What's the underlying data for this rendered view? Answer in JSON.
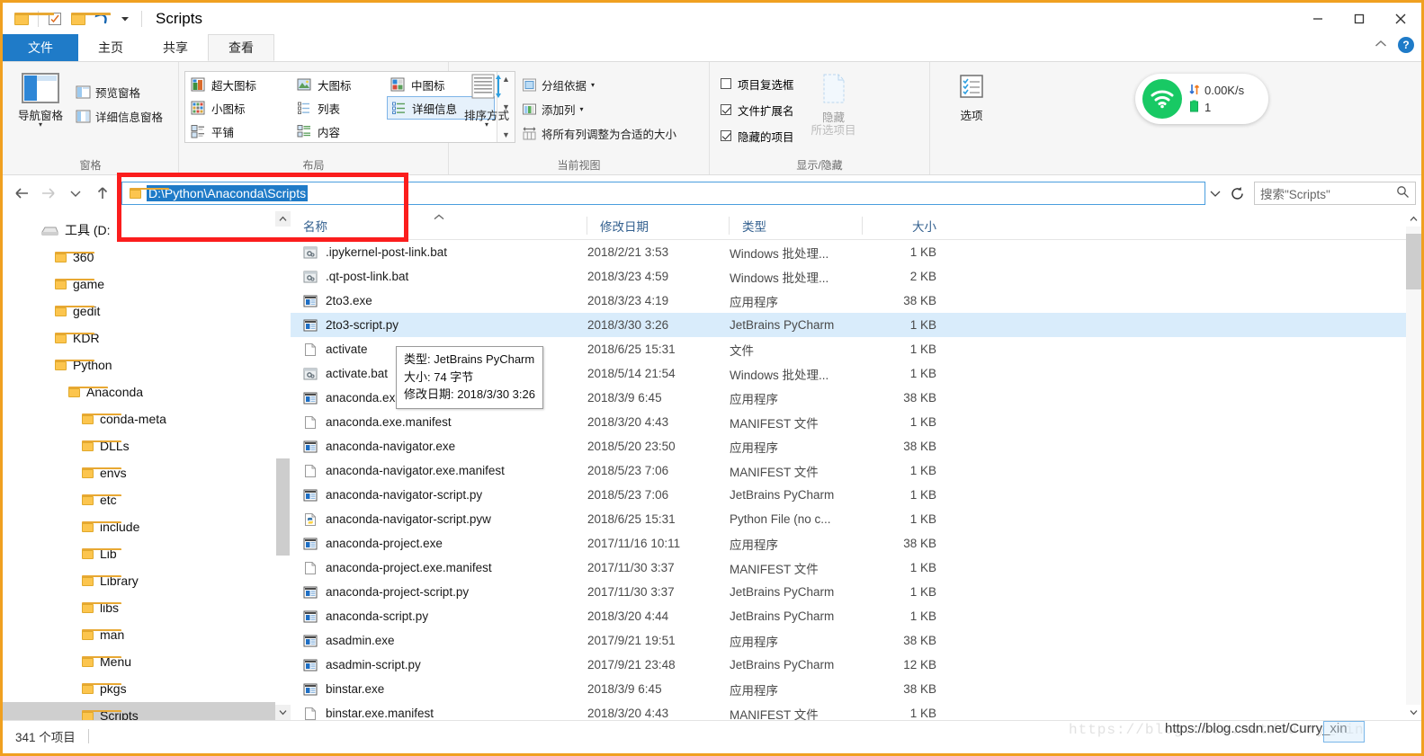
{
  "window": {
    "title": "Scripts",
    "minimize": "—",
    "maximize": "□",
    "close": "✕",
    "ribbon_collapse": "^",
    "help": "?"
  },
  "quick_access": {
    "folder_icon": "folder-icon",
    "properties_icon": "properties-checkbox-icon",
    "new_folder_icon": "new-folder-icon",
    "undo_icon": "undo-icon",
    "customize_icon": "chevron-down-icon"
  },
  "tabs": [
    {
      "label": "文件",
      "kind": "file"
    },
    {
      "label": "主页",
      "kind": "normal"
    },
    {
      "label": "共享",
      "kind": "normal"
    },
    {
      "label": "查看",
      "kind": "active"
    }
  ],
  "ribbon": {
    "groups": [
      {
        "name": "panes",
        "label": "窗格",
        "big_button": {
          "label": "导航窗格",
          "icon": "navigation-pane-icon"
        },
        "small_buttons": [
          {
            "label": "预览窗格",
            "icon": "preview-pane-icon"
          },
          {
            "label": "详细信息窗格",
            "icon": "details-pane-icon"
          }
        ]
      },
      {
        "name": "layout",
        "label": "布局",
        "items": [
          {
            "label": "超大图标",
            "icon": "extra-large-icons-icon",
            "selected": false
          },
          {
            "label": "大图标",
            "icon": "large-icons-icon",
            "selected": false
          },
          {
            "label": "中图标",
            "icon": "medium-icons-icon",
            "selected": false
          },
          {
            "label": "小图标",
            "icon": "small-icons-icon",
            "selected": false
          },
          {
            "label": "列表",
            "icon": "list-view-icon",
            "selected": false
          },
          {
            "label": "详细信息",
            "icon": "details-view-icon",
            "selected": true
          },
          {
            "label": "平铺",
            "icon": "tiles-view-icon",
            "selected": false
          },
          {
            "label": "内容",
            "icon": "content-view-icon",
            "selected": false
          }
        ]
      },
      {
        "name": "current_view",
        "label": "当前视图",
        "big_button": {
          "label": "排序方式",
          "icon": "sort-by-icon"
        },
        "small_buttons": [
          {
            "label": "分组依据",
            "icon": "group-by-icon",
            "has_caret": true
          },
          {
            "label": "添加列",
            "icon": "add-columns-icon",
            "has_caret": true
          },
          {
            "label": "将所有列调整为合适的大小",
            "icon": "size-columns-to-fit-icon",
            "has_caret": false
          }
        ]
      },
      {
        "name": "show_hide",
        "label": "显示/隐藏",
        "checkboxes": [
          {
            "label": "项目复选框",
            "checked": false
          },
          {
            "label": "文件扩展名",
            "checked": true
          },
          {
            "label": "隐藏的项目",
            "checked": true
          }
        ],
        "big_button": {
          "label_line1": "隐藏",
          "label_line2": "所选项目",
          "icon": "hide-selected-items-icon",
          "disabled": true
        }
      },
      {
        "name": "options",
        "label": "",
        "big_button": {
          "label": "选项",
          "icon": "options-icon"
        }
      }
    ]
  },
  "net_widget": {
    "icon": "wifi-icon",
    "speed": "0.00K/s",
    "speed_icon": "up-down-arrow-icon",
    "battery_value": "1",
    "battery_icon": "battery-icon",
    "accent": "#18c964"
  },
  "address_bar": {
    "back_icon": "back-arrow-icon",
    "forward_icon": "forward-arrow-icon",
    "recent_icon": "chevron-down-icon",
    "up_icon": "up-arrow-icon",
    "folder_icon": "folder-icon",
    "path": "D:\\Python\\Anaconda\\Scripts",
    "dropdown_icon": "chevron-down-icon",
    "refresh_icon": "refresh-icon"
  },
  "search": {
    "placeholder": "搜索\"Scripts\"",
    "icon": "search-icon"
  },
  "nav_pane": {
    "items": [
      {
        "label": "工具 (D:",
        "icon": "drive-icon",
        "indent": 0,
        "selected": false
      },
      {
        "label": "360",
        "icon": "folder-icon",
        "indent": 1,
        "selected": false
      },
      {
        "label": "game",
        "icon": "folder-icon",
        "indent": 1,
        "selected": false
      },
      {
        "label": "gedit",
        "icon": "folder-icon",
        "indent": 1,
        "selected": false
      },
      {
        "label": "KDR",
        "icon": "folder-icon",
        "indent": 1,
        "selected": false
      },
      {
        "label": "Python",
        "icon": "folder-icon",
        "indent": 1,
        "selected": false
      },
      {
        "label": "Anaconda",
        "icon": "folder-icon",
        "indent": 2,
        "selected": false
      },
      {
        "label": "conda-meta",
        "icon": "folder-icon",
        "indent": 3,
        "selected": false
      },
      {
        "label": "DLLs",
        "icon": "folder-icon",
        "indent": 3,
        "selected": false
      },
      {
        "label": "envs",
        "icon": "folder-icon",
        "indent": 3,
        "selected": false
      },
      {
        "label": "etc",
        "icon": "folder-icon",
        "indent": 3,
        "selected": false
      },
      {
        "label": "include",
        "icon": "folder-icon",
        "indent": 3,
        "selected": false
      },
      {
        "label": "Lib",
        "icon": "folder-icon",
        "indent": 3,
        "selected": false
      },
      {
        "label": "Library",
        "icon": "folder-icon",
        "indent": 3,
        "selected": false
      },
      {
        "label": "libs",
        "icon": "folder-icon",
        "indent": 3,
        "selected": false
      },
      {
        "label": "man",
        "icon": "folder-icon",
        "indent": 3,
        "selected": false
      },
      {
        "label": "Menu",
        "icon": "folder-icon",
        "indent": 3,
        "selected": false
      },
      {
        "label": "pkgs",
        "icon": "folder-icon",
        "indent": 3,
        "selected": false
      },
      {
        "label": "Scripts",
        "icon": "folder-icon",
        "indent": 3,
        "selected": true
      }
    ]
  },
  "file_list": {
    "columns": [
      {
        "key": "name",
        "label": "名称",
        "sorted": true,
        "sort_dir": "asc"
      },
      {
        "key": "date",
        "label": "修改日期",
        "sorted": false
      },
      {
        "key": "type",
        "label": "类型",
        "sorted": false
      },
      {
        "key": "size",
        "label": "大小",
        "sorted": false
      }
    ],
    "rows": [
      {
        "name": ".ipykernel-post-link.bat",
        "date": "2018/2/21 3:53",
        "type": "Windows 批处理...",
        "size": "1 KB",
        "icon": "bat-file-icon",
        "selected": false
      },
      {
        "name": ".qt-post-link.bat",
        "date": "2018/3/23 4:59",
        "type": "Windows 批处理...",
        "size": "2 KB",
        "icon": "bat-file-icon",
        "selected": false
      },
      {
        "name": "2to3.exe",
        "date": "2018/3/23 4:19",
        "type": "应用程序",
        "size": "38 KB",
        "icon": "exe-file-icon",
        "selected": false
      },
      {
        "name": "2to3-script.py",
        "date": "2018/3/30 3:26",
        "type": "JetBrains PyCharm",
        "size": "1 KB",
        "icon": "exe-file-icon",
        "selected": true
      },
      {
        "name": "activate",
        "date": "2018/6/25 15:31",
        "type": "文件",
        "size": "1 KB",
        "icon": "blank-file-icon",
        "selected": false
      },
      {
        "name": "activate.bat",
        "date": "2018/5/14 21:54",
        "type": "Windows 批处理...",
        "size": "1 KB",
        "icon": "bat-file-icon",
        "selected": false
      },
      {
        "name": "anaconda.exe",
        "date": "2018/3/9 6:45",
        "type": "应用程序",
        "size": "38 KB",
        "icon": "exe-file-icon",
        "selected": false
      },
      {
        "name": "anaconda.exe.manifest",
        "date": "2018/3/20 4:43",
        "type": "MANIFEST 文件",
        "size": "1 KB",
        "icon": "blank-file-icon",
        "selected": false
      },
      {
        "name": "anaconda-navigator.exe",
        "date": "2018/5/20 23:50",
        "type": "应用程序",
        "size": "38 KB",
        "icon": "exe-file-icon",
        "selected": false
      },
      {
        "name": "anaconda-navigator.exe.manifest",
        "date": "2018/5/23 7:06",
        "type": "MANIFEST 文件",
        "size": "1 KB",
        "icon": "blank-file-icon",
        "selected": false
      },
      {
        "name": "anaconda-navigator-script.py",
        "date": "2018/5/23 7:06",
        "type": "JetBrains PyCharm",
        "size": "1 KB",
        "icon": "exe-file-icon",
        "selected": false
      },
      {
        "name": "anaconda-navigator-script.pyw",
        "date": "2018/6/25 15:31",
        "type": "Python File (no c...",
        "size": "1 KB",
        "icon": "python-file-icon",
        "selected": false
      },
      {
        "name": "anaconda-project.exe",
        "date": "2017/11/16 10:11",
        "type": "应用程序",
        "size": "38 KB",
        "icon": "exe-file-icon",
        "selected": false
      },
      {
        "name": "anaconda-project.exe.manifest",
        "date": "2017/11/30 3:37",
        "type": "MANIFEST 文件",
        "size": "1 KB",
        "icon": "blank-file-icon",
        "selected": false
      },
      {
        "name": "anaconda-project-script.py",
        "date": "2017/11/30 3:37",
        "type": "JetBrains PyCharm",
        "size": "1 KB",
        "icon": "exe-file-icon",
        "selected": false
      },
      {
        "name": "anaconda-script.py",
        "date": "2018/3/20 4:44",
        "type": "JetBrains PyCharm",
        "size": "1 KB",
        "icon": "exe-file-icon",
        "selected": false
      },
      {
        "name": "asadmin.exe",
        "date": "2017/9/21 19:51",
        "type": "应用程序",
        "size": "38 KB",
        "icon": "exe-file-icon",
        "selected": false
      },
      {
        "name": "asadmin-script.py",
        "date": "2017/9/21 23:48",
        "type": "JetBrains PyCharm",
        "size": "12 KB",
        "icon": "exe-file-icon",
        "selected": false
      },
      {
        "name": "binstar.exe",
        "date": "2018/3/9 6:45",
        "type": "应用程序",
        "size": "38 KB",
        "icon": "exe-file-icon",
        "selected": false
      },
      {
        "name": "binstar.exe.manifest",
        "date": "2018/3/20 4:43",
        "type": "MANIFEST 文件",
        "size": "1 KB",
        "icon": "blank-file-icon",
        "selected": false
      }
    ]
  },
  "tooltip": {
    "line1": "类型: JetBrains PyCharm",
    "line2": "大小: 74 字节",
    "line3": "修改日期: 2018/3/30 3:26"
  },
  "status_bar": {
    "item_count": "341 个项目"
  },
  "watermark": {
    "faded": "https://blog.csdn.net/Curry_xin",
    "overlay": "https://blog.csdn.net/Curry_xin"
  }
}
